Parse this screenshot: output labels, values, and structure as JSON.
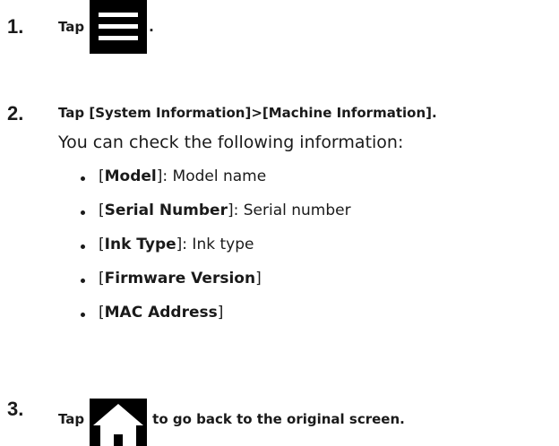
{
  "steps": [
    {
      "number": "1.",
      "before": "Tap",
      "icon": "menu-icon",
      "after": "."
    },
    {
      "number": "2.",
      "text": "Tap [System Information]>[Machine Information].",
      "description": "You can check the following information:",
      "items": [
        {
          "open": "[",
          "label": "Model",
          "close": "]",
          "desc": ": Model name"
        },
        {
          "open": "[",
          "label": "Serial Number",
          "close": "]",
          "desc": ": Serial number"
        },
        {
          "open": "[",
          "label": "Ink Type",
          "close": "]",
          "desc": ": Ink type"
        },
        {
          "open": "[",
          "label": "Firmware Version",
          "close": "]",
          "desc": ""
        },
        {
          "open": "[",
          "label": "MAC Address",
          "close": "]",
          "desc": ""
        }
      ]
    },
    {
      "number": "3.",
      "before": "Tap",
      "icon": "home-icon",
      "after": "to go back to the original screen."
    }
  ],
  "colors": {
    "text": "#1a1a1a",
    "icon_bg": "#000000",
    "icon_fg": "#ffffff"
  }
}
